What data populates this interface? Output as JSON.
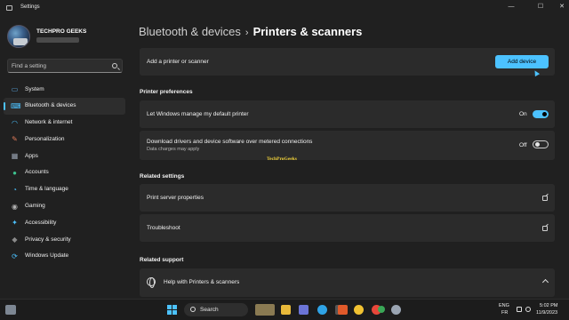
{
  "window": {
    "title": "Settings",
    "controls": {
      "minimize": "—",
      "maximize": "☐",
      "close": "✕"
    }
  },
  "profile": {
    "name": "TECHPRO GEEKS"
  },
  "search": {
    "placeholder": "Find a setting"
  },
  "sidebar": {
    "items": [
      {
        "label": "System",
        "icon": "monitor-icon",
        "color": "#5aa9e6"
      },
      {
        "label": "Bluetooth & devices",
        "icon": "bluetooth-devices-icon",
        "color": "#4cc2ff",
        "active": true
      },
      {
        "label": "Network & internet",
        "icon": "wifi-icon",
        "color": "#4cc2ff"
      },
      {
        "label": "Personalization",
        "icon": "brush-icon",
        "color": "#e07b5a"
      },
      {
        "label": "Apps",
        "icon": "apps-icon",
        "color": "#9aa4b2"
      },
      {
        "label": "Accounts",
        "icon": "person-icon",
        "color": "#3ec28f"
      },
      {
        "label": "Time & language",
        "icon": "globe-clock-icon",
        "color": "#4cc2ff"
      },
      {
        "label": "Gaming",
        "icon": "controller-icon",
        "color": "#b0b0b0"
      },
      {
        "label": "Accessibility",
        "icon": "accessibility-icon",
        "color": "#4cc2ff"
      },
      {
        "label": "Privacy & security",
        "icon": "shield-icon",
        "color": "#8a8a8a"
      },
      {
        "label": "Windows Update",
        "icon": "update-icon",
        "color": "#4cc2ff"
      }
    ]
  },
  "breadcrumb": {
    "parent": "Bluetooth & devices",
    "separator": "›",
    "current": "Printers & scanners"
  },
  "add_printer": {
    "label": "Add a printer or scanner",
    "button": "Add device"
  },
  "printer_preferences": {
    "heading": "Printer preferences",
    "manage_default": {
      "label": "Let Windows manage my default printer",
      "state": "On",
      "on": true
    },
    "metered": {
      "label": "Download drivers and device software over metered connections",
      "sub": "Data charges may apply",
      "state": "Off",
      "on": false
    }
  },
  "watermark": "TechProGeeks",
  "related_settings": {
    "heading": "Related settings",
    "items": [
      {
        "label": "Print server properties"
      },
      {
        "label": "Troubleshoot"
      }
    ]
  },
  "related_support": {
    "heading": "Related support",
    "help": {
      "label": "Help with Printers & scanners"
    }
  },
  "taskbar": {
    "search_label": "Search",
    "language": "ENG",
    "region": "FR",
    "time": "5:02 PM",
    "date": "11/9/2023",
    "apps": [
      {
        "name": "file-explorer-icon",
        "color": "#e8b93a"
      },
      {
        "name": "chat-icon",
        "color": "#6b74d6"
      },
      {
        "name": "edge-icon",
        "color": "#2fa3e6"
      },
      {
        "name": "camera-icon",
        "color": "#555555"
      },
      {
        "name": "store-icon",
        "color": "#e15a2a"
      },
      {
        "name": "photos-icon",
        "color": "#f1c232"
      },
      {
        "name": "chrome-icon",
        "color": "#e8473a"
      },
      {
        "name": "chrome-alt-icon",
        "color": "#3aa757"
      },
      {
        "name": "settings-icon",
        "color": "#9aa4b2"
      }
    ]
  }
}
